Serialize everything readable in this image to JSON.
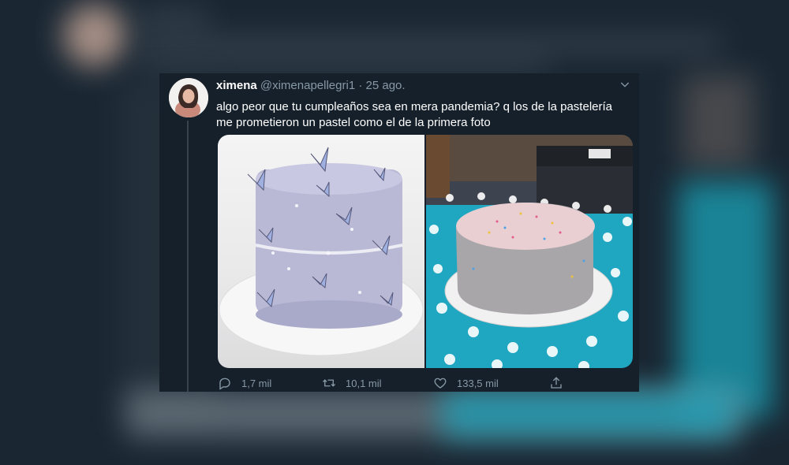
{
  "tweet": {
    "display_name": "ximena",
    "handle": "@ximenapellegri1",
    "separator": " · ",
    "date": "25 ago.",
    "text_line1": "algo peor que tu cumpleaños sea en mera pandemia? q los de la pastelería",
    "text_line2": "me prometieron un pastel como el de la primera foto",
    "replies": "1,7 mil",
    "retweets": "10,1 mil",
    "likes": "133,5 mil"
  },
  "icons": {
    "more": "chevron-down-icon",
    "reply": "reply-icon",
    "retweet": "retweet-icon",
    "like": "heart-icon",
    "share": "share-icon"
  },
  "colors": {
    "background": "#15202b",
    "text": "#ffffff",
    "secondary_text": "#8899a6",
    "thread_line": "#38444d"
  }
}
